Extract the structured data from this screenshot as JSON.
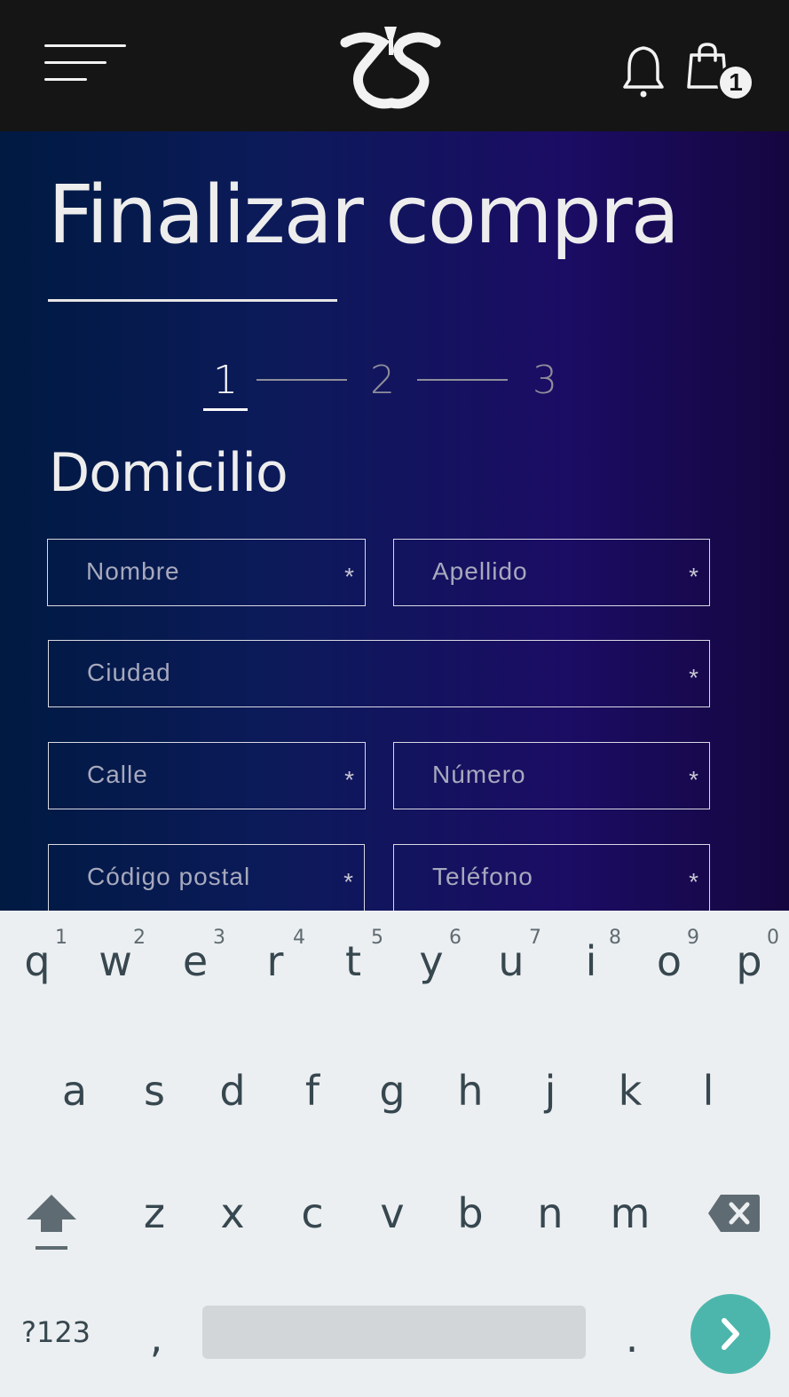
{
  "header": {
    "menu_icon": "hamburger-menu-icon",
    "logo_icon": "brand-logo-icon",
    "notification_icon": "bell-icon",
    "cart_icon": "shopping-bag-icon",
    "cart_count": "1"
  },
  "page": {
    "title": "Finalizar compra",
    "steps": [
      "1",
      "2",
      "3"
    ],
    "active_step": "1",
    "section_title": "Domicilio"
  },
  "form": {
    "nombre": {
      "placeholder": "Nombre",
      "required_mark": "*"
    },
    "apellido": {
      "placeholder": "Apellido",
      "required_mark": "*"
    },
    "ciudad": {
      "placeholder": "Ciudad",
      "required_mark": "*"
    },
    "calle": {
      "placeholder": "Calle",
      "required_mark": "*"
    },
    "numero": {
      "placeholder": "Número",
      "required_mark": "*"
    },
    "codigo_postal": {
      "placeholder": "Código postal",
      "required_mark": "*"
    },
    "telefono": {
      "placeholder": "Teléfono",
      "required_mark": "*"
    }
  },
  "keyboard": {
    "row1": [
      "q",
      "w",
      "e",
      "r",
      "t",
      "y",
      "u",
      "i",
      "o",
      "p"
    ],
    "row1_hints": [
      "1",
      "2",
      "3",
      "4",
      "5",
      "6",
      "7",
      "8",
      "9",
      "0"
    ],
    "row2": [
      "a",
      "s",
      "d",
      "f",
      "g",
      "h",
      "j",
      "k",
      "l"
    ],
    "row3": [
      "z",
      "x",
      "c",
      "v",
      "b",
      "n",
      "m"
    ],
    "symbols_label": "?123",
    "comma": ",",
    "period": ".",
    "shift_icon": "shift-arrow-icon",
    "backspace_icon": "backspace-icon",
    "go_icon": "chevron-right-icon"
  },
  "colors": {
    "header_bg": "#151515",
    "gradient_start": "#001a42",
    "gradient_end": "#1b0c64",
    "keyboard_bg": "#eceff1",
    "go_button": "#4db6ac"
  }
}
